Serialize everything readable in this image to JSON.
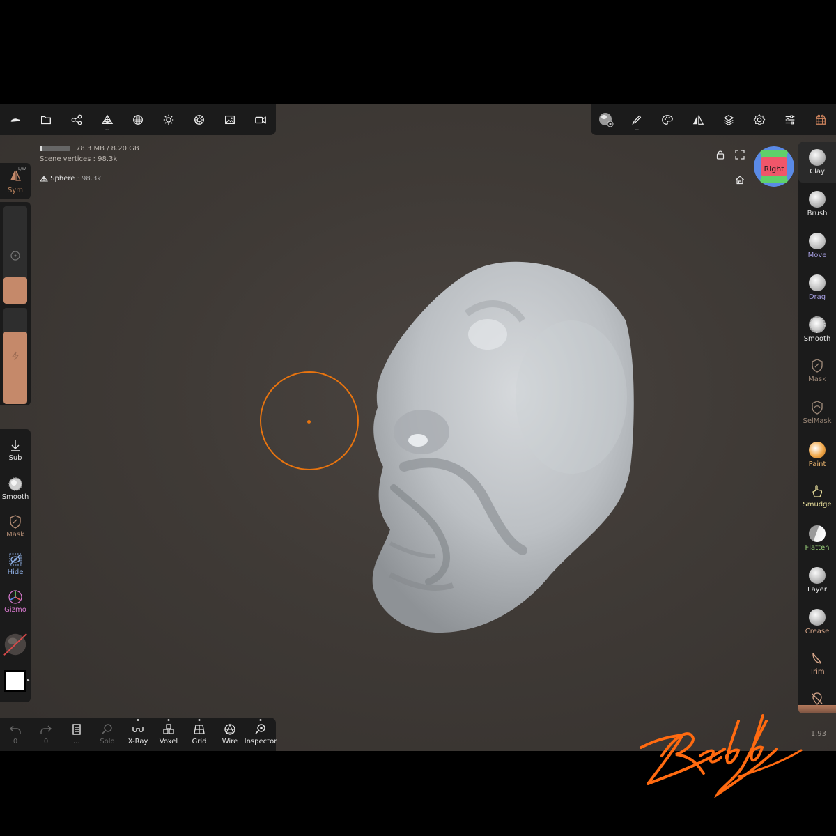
{
  "info": {
    "memory": "78.3 MB / 8.20 GB",
    "scene_vertices": "Scene vertices : 98.3k",
    "object_name": "Sphere",
    "object_count": "· 98.3k"
  },
  "top_left_toolbar": {
    "items": [
      "logo-icon",
      "folder-icon",
      "scene-graph-icon",
      "topology-icon",
      "material-icon",
      "light-icon",
      "shading-icon",
      "background-icon",
      "camera-icon"
    ],
    "topology_dots": "..."
  },
  "top_right_toolbar": {
    "items": [
      "matcap-icon",
      "stroke-icon",
      "palette-icon",
      "symmetry-icon",
      "layers-icon",
      "settings-icon",
      "sliders-icon",
      "store-icon"
    ],
    "stroke_dots": "..."
  },
  "left_panel": {
    "sym_label": "Sym",
    "sym_lw": "L/W",
    "tools": [
      {
        "label": "Sub",
        "color": "#e6e6e6"
      },
      {
        "label": "Smooth",
        "color": "#e6e6e6"
      },
      {
        "label": "Mask",
        "color": "#b08a72"
      },
      {
        "label": "Hide",
        "color": "#8fb0e6"
      },
      {
        "label": "Gizmo",
        "color": "#d97ad0"
      }
    ],
    "color_swatch": "#ffffff"
  },
  "bottom_bar": {
    "items": [
      {
        "label": "0",
        "dim": true
      },
      {
        "label": "0",
        "dim": true
      },
      {
        "label": "...",
        "dim": false
      },
      {
        "label": "Solo",
        "dim": true
      },
      {
        "label": "X-Ray",
        "dim": false
      },
      {
        "label": "Voxel",
        "dim": false
      },
      {
        "label": "Grid",
        "dim": false
      },
      {
        "label": "Wire",
        "dim": false
      },
      {
        "label": "Inspector",
        "dim": false
      }
    ]
  },
  "right_panel": {
    "tools": [
      {
        "label": "Clay",
        "color": "#e6e6e6"
      },
      {
        "label": "Brush",
        "color": "#e6e6e6"
      },
      {
        "label": "Move",
        "color": "#a59ee0"
      },
      {
        "label": "Drag",
        "color": "#a59ee0"
      },
      {
        "label": "Smooth",
        "color": "#e6e6e6"
      },
      {
        "label": "Mask",
        "color": "#9a8676"
      },
      {
        "label": "SelMask",
        "color": "#9a8676"
      },
      {
        "label": "Paint",
        "color": "#e8b36e"
      },
      {
        "label": "Smudge",
        "color": "#e6dc9a"
      },
      {
        "label": "Flatten",
        "color": "#9ad07a"
      },
      {
        "label": "Layer",
        "color": "#e6e6e6"
      },
      {
        "label": "Crease",
        "color": "#d7a68a"
      },
      {
        "label": "Trim",
        "color": "#d7a68a"
      }
    ]
  },
  "view_cube": {
    "label": "Right"
  },
  "version": "1.93",
  "signature": "Reddy",
  "colors": {
    "accent": "#c5896a",
    "brush": "#e8740f",
    "panel": "#1b1b1b"
  }
}
